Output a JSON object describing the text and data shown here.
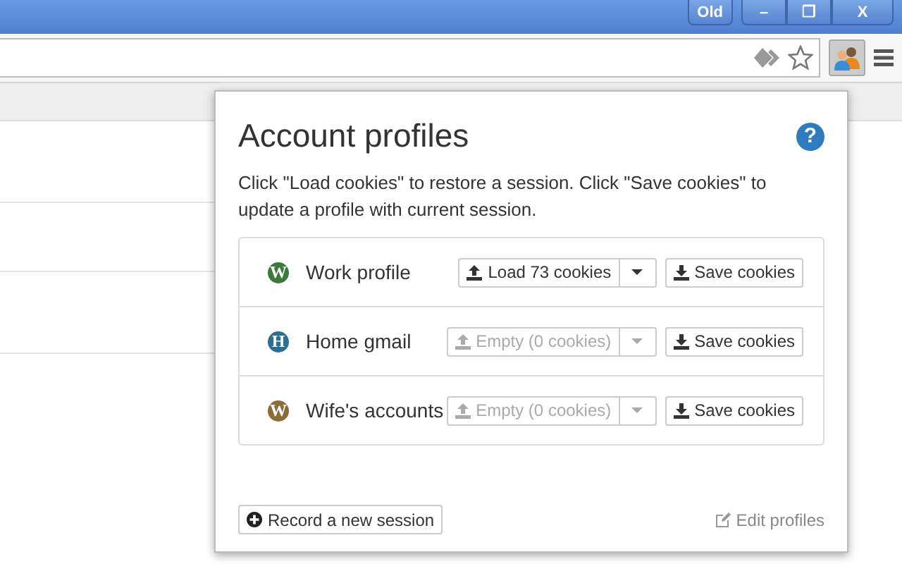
{
  "window": {
    "badge": "Old",
    "controls": [
      "–",
      "❐",
      "X"
    ]
  },
  "popup": {
    "title": "Account profiles",
    "help": "?",
    "description": "Click \"Load cookies\" to restore a session. Click \"Save cookies\" to update a profile with current session.",
    "profiles": [
      {
        "letter": "W",
        "color": "#3b7a3b",
        "name": "Work profile",
        "load": "Load 73 cookies",
        "disabled": false,
        "save": "Save cookies"
      },
      {
        "letter": "H",
        "color": "#2e6e93",
        "name": "Home gmail",
        "load": "Empty (0 cookies)",
        "disabled": true,
        "save": "Save cookies"
      },
      {
        "letter": "W",
        "color": "#8c6d3a",
        "name": "Wife's accounts",
        "load": "Empty (0 cookies)",
        "disabled": true,
        "save": "Save cookies"
      }
    ],
    "record": "Record a new session",
    "edit": "Edit profiles"
  }
}
